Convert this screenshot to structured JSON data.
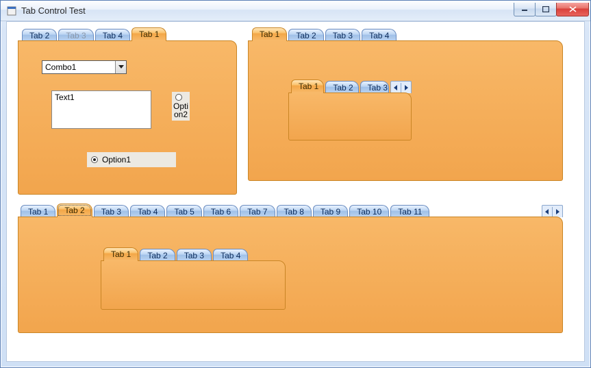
{
  "window": {
    "title": "Tab Control Test"
  },
  "panel_top_left": {
    "tabs": [
      "Tab 2",
      "Tab 3",
      "Tab 4",
      "Tab 1"
    ],
    "selected_index": 3,
    "disabled_index": 1,
    "combo_value": "Combo1",
    "text_value": "Text1",
    "option1_label": "Option1",
    "option2_label": "Option2"
  },
  "panel_top_right": {
    "tabs": [
      "Tab 1",
      "Tab 2",
      "Tab 3",
      "Tab 4"
    ],
    "selected_index": 0,
    "inner": {
      "tabs": [
        "Tab 1",
        "Tab 2",
        "Tab 3"
      ],
      "selected_index": 0,
      "has_scroll": true
    }
  },
  "panel_bottom": {
    "tabs": [
      "Tab 1",
      "Tab 2",
      "Tab 3",
      "Tab 4",
      "Tab 5",
      "Tab 6",
      "Tab 7",
      "Tab 8",
      "Tab 9",
      "Tab 10",
      "Tab 11"
    ],
    "selected_index": 1,
    "has_scroll": true,
    "inner": {
      "tabs": [
        "Tab 1",
        "Tab 2",
        "Tab 3",
        "Tab 4"
      ],
      "selected_index": 0
    }
  }
}
